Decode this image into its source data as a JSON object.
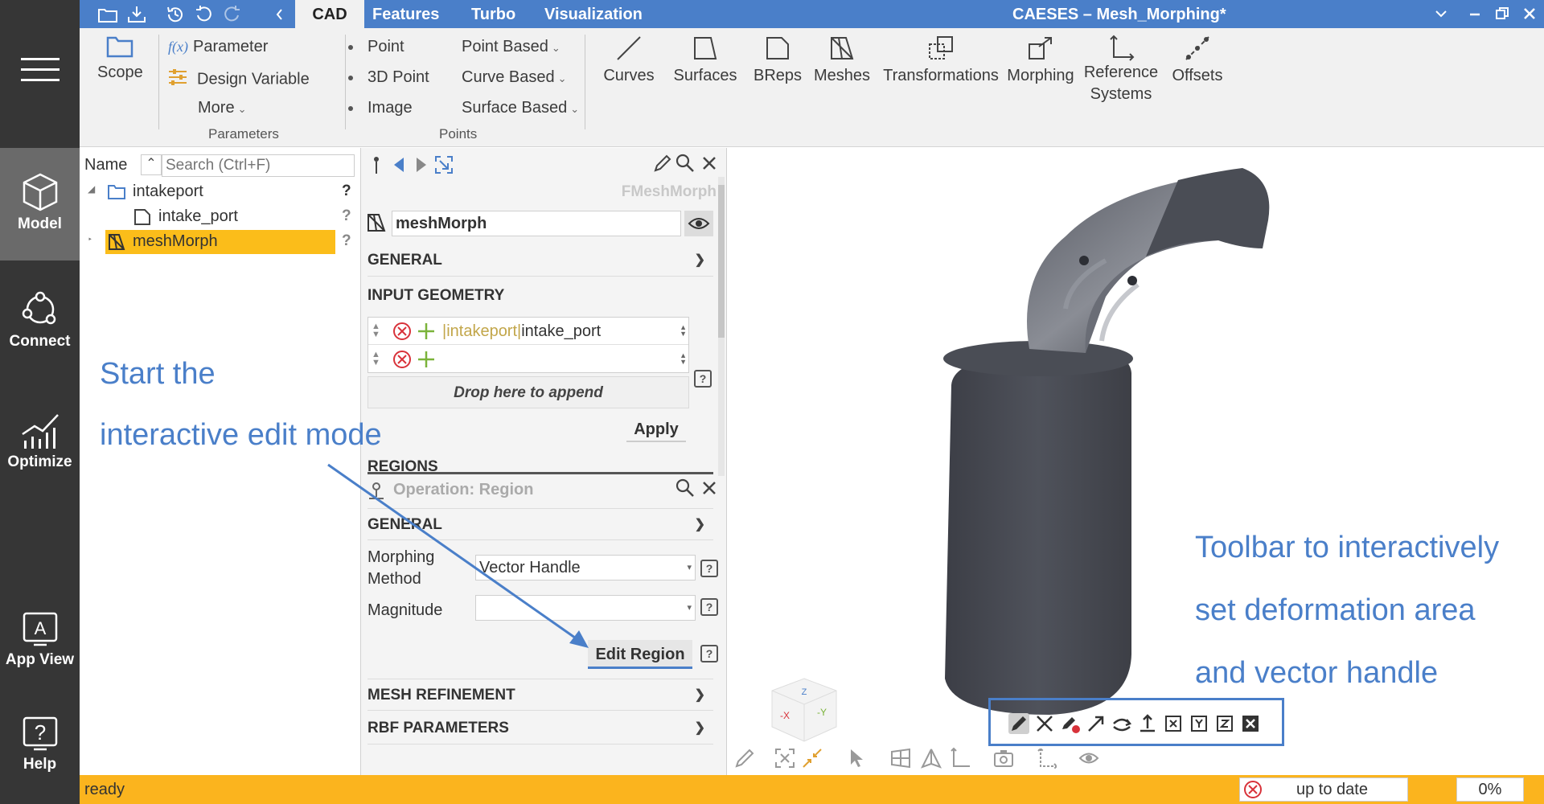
{
  "window": {
    "title": "CAESES – Mesh_Morphing*"
  },
  "tabs": [
    {
      "label": "CAD",
      "active": true
    },
    {
      "label": "Features",
      "active": false
    },
    {
      "label": "Turbo",
      "active": false
    },
    {
      "label": "Visualization",
      "active": false
    }
  ],
  "rail": {
    "items": [
      {
        "label": "Model",
        "icon": "cube-icon",
        "active": true
      },
      {
        "label": "Connect",
        "icon": "connect-icon",
        "active": false
      },
      {
        "label": "Optimize",
        "icon": "chart-icon",
        "active": false
      },
      {
        "label": "App View",
        "icon": "app-icon",
        "active": false
      },
      {
        "label": "Help",
        "icon": "help-icon",
        "active": false
      }
    ]
  },
  "ribbon": {
    "scope": "Scope",
    "parameter": "Parameter",
    "design_variable": "Design Variable",
    "more": "More",
    "group_parameters": "Parameters",
    "point": "Point",
    "point_3d": "3D Point",
    "image": "Image",
    "point_based": "Point Based",
    "curve_based": "Curve Based",
    "surface_based": "Surface Based",
    "group_points": "Points",
    "curves": "Curves",
    "surfaces": "Surfaces",
    "breps": "BReps",
    "meshes": "Meshes",
    "transformations": "Transformations",
    "morphing": "Morphing",
    "reference_systems_1": "Reference",
    "reference_systems_2": "Systems",
    "offsets": "Offsets"
  },
  "tree": {
    "name_header": "Name",
    "search_placeholder": "Search (Ctrl+F)",
    "items": [
      {
        "label": "intakeport",
        "badge": "?"
      },
      {
        "label": "intake_port",
        "badge": "?"
      },
      {
        "label": "meshMorph",
        "badge": "?"
      }
    ]
  },
  "props": {
    "type_label": "FMeshMorph",
    "object_name": "meshMorph",
    "section_general": "GENERAL",
    "section_input_geometry": "INPUT GEOMETRY",
    "input_path": "|intakeport|",
    "input_value": "intake_port",
    "drop_here": "Drop here to append",
    "apply": "Apply",
    "section_regions": "REGIONS",
    "operation_title": "Operation: Region",
    "section_general2": "GENERAL",
    "morphing_method_label_1": "Morphing",
    "morphing_method_label_2": "Method",
    "morphing_method_value": "Vector Handle",
    "magnitude_label": "Magnitude",
    "magnitude_value": "",
    "edit_region": "Edit Region",
    "section_mesh_refinement": "MESH REFINEMENT",
    "section_rbf": "RBF PARAMETERS"
  },
  "annotations": {
    "left_line1": "Start the",
    "left_line2": "interactive edit mode",
    "right_line1": "Toolbar to interactively",
    "right_line2": "set deformation area",
    "right_line3": "and vector handle"
  },
  "viewcube": {
    "x_label": "-X",
    "y_label": "-Y",
    "z_label": "Z"
  },
  "status": {
    "text": "ready",
    "sync": "up to date",
    "progress": "0%"
  },
  "colors": {
    "accent": "#4a7fc9",
    "status_bar": "#fbb41e",
    "selection": "#fbbd1a",
    "rail": "#363636"
  }
}
